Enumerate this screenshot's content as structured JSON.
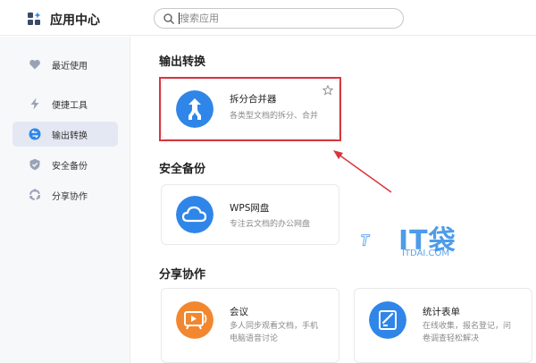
{
  "header": {
    "app_title": "应用中心",
    "search_placeholder": "搜索应用"
  },
  "sidebar": {
    "items": [
      {
        "label": "最近使用",
        "icon": "heart-icon",
        "active": false
      },
      {
        "label": "便捷工具",
        "icon": "lightning-icon",
        "active": false
      },
      {
        "label": "输出转换",
        "icon": "convert-icon",
        "active": true
      },
      {
        "label": "安全备份",
        "icon": "shield-icon",
        "active": false
      },
      {
        "label": "分享协作",
        "icon": "share-ring-icon",
        "active": false
      }
    ]
  },
  "sections": {
    "output": {
      "title": "输出转换",
      "cards": [
        {
          "title": "拆分合并器",
          "desc": "各类型文档的拆分、合并",
          "icon": "split-merge-icon",
          "color": "#2f86e8"
        }
      ]
    },
    "backup": {
      "title": "安全备份",
      "cards": [
        {
          "title": "WPS网盘",
          "desc": "专注云文档的办公网盘",
          "icon": "cloud-icon",
          "color": "#2f86e8"
        }
      ]
    },
    "share": {
      "title": "分享协作",
      "cards": [
        {
          "title": "会议",
          "desc_line1": "多人同步观看文档，手机",
          "desc_line2": "电脑语音讨论",
          "icon": "meeting-icon",
          "color": "#f2872f"
        },
        {
          "title": "统计表单",
          "desc_line1": "在线收集，报名登记，问",
          "desc_line2": "卷调查轻松解决",
          "icon": "form-icon",
          "color": "#2f86e8"
        }
      ]
    }
  },
  "annotation": {
    "color": "#d9363e"
  },
  "watermark": {
    "text": "IT袋",
    "sub": "ITDAI.COM",
    "color": "#2f8be6"
  }
}
